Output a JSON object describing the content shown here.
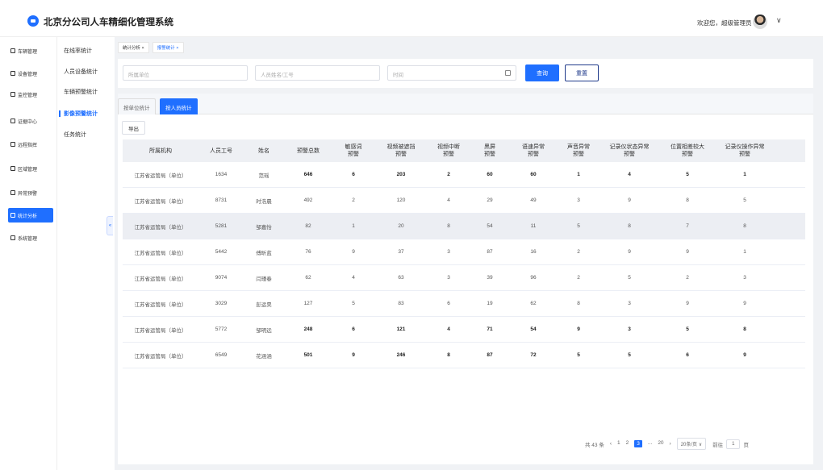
{
  "header": {
    "title": "北京分公司人车精细化管理系统",
    "welcome": "欢迎您，超级管理员",
    "caret": "∨"
  },
  "sidebar": {
    "items": [
      {
        "label": "车辆管理",
        "icon": "car-icon"
      },
      {
        "label": "设备管理",
        "icon": "device-icon"
      },
      {
        "label": "监控管理",
        "icon": "monitor-icon"
      },
      {
        "label": "证据中心",
        "icon": "evidence-icon"
      },
      {
        "label": "远程指挥",
        "icon": "command-icon"
      },
      {
        "label": "区域管理",
        "icon": "region-icon"
      },
      {
        "label": "异常预警",
        "icon": "warning-icon"
      },
      {
        "label": "统计分析",
        "icon": "chart-icon"
      },
      {
        "label": "系统管理",
        "icon": "settings-icon"
      }
    ],
    "active_index": 7
  },
  "subsidebar": {
    "items": [
      "在线率统计",
      "人员设备统计",
      "车辆预警统计",
      "影像预警统计",
      "任务统计"
    ],
    "active_index": 3,
    "collapse_glyph": "«"
  },
  "breadcrumbs": [
    {
      "label": "统计分析 ×"
    },
    {
      "label": "报警统计 ×"
    }
  ],
  "search": {
    "unit_placeholder": "所属单位",
    "person_placeholder": "人员姓名/工号",
    "time_placeholder": "时间",
    "query_label": "查询",
    "reset_label": "重置"
  },
  "tabs": [
    "按单位统计",
    "按人员统计"
  ],
  "active_tab": 1,
  "export_label": "导出",
  "table": {
    "headers": [
      [
        "所属机构"
      ],
      [
        "人员工号"
      ],
      [
        "姓名"
      ],
      [
        "预警总数"
      ],
      [
        "敏感词",
        "预警"
      ],
      [
        "视频被遮挡",
        "预警"
      ],
      [
        "视频中断",
        "预警"
      ],
      [
        "黑屏",
        "预警"
      ],
      [
        "语速异常",
        "预警"
      ],
      [
        "声音异常",
        "预警"
      ],
      [
        "记录仪状态异常",
        "预警"
      ],
      [
        "位置相差较大",
        "预警"
      ],
      [
        "记录仪操作异常",
        "预警"
      ]
    ],
    "rows": [
      [
        "江苏省运管局（单位）",
        "1634",
        "范瑶",
        "646",
        "6",
        "203",
        "2",
        "60",
        "60",
        "1",
        "4",
        "5",
        "1"
      ],
      [
        "江苏省运管局（单位）",
        "8731",
        "时浩晨",
        "492",
        "2",
        "120",
        "4",
        "29",
        "49",
        "3",
        "9",
        "8",
        "5"
      ],
      [
        "江苏省运管局（单位）",
        "5281",
        "邹嘉怡",
        "82",
        "1",
        "20",
        "8",
        "54",
        "11",
        "5",
        "8",
        "7",
        "8"
      ],
      [
        "江苏省运管局（单位）",
        "5442",
        "傅昕蓝",
        "76",
        "9",
        "37",
        "3",
        "87",
        "16",
        "2",
        "9",
        "9",
        "1"
      ],
      [
        "江苏省运管局（单位）",
        "9074",
        "闫瑾春",
        "62",
        "4",
        "63",
        "3",
        "39",
        "96",
        "2",
        "5",
        "2",
        "3"
      ],
      [
        "江苏省运管局（单位）",
        "3029",
        "彭运昊",
        "127",
        "5",
        "83",
        "6",
        "19",
        "62",
        "8",
        "3",
        "9",
        "9"
      ],
      [
        "江苏省运管局（单位）",
        "5772",
        "邹明远",
        "248",
        "6",
        "121",
        "4",
        "71",
        "54",
        "9",
        "3",
        "5",
        "8"
      ],
      [
        "江苏省运管局（单位）",
        "6549",
        "花涵涵",
        "501",
        "9",
        "246",
        "8",
        "87",
        "72",
        "5",
        "5",
        "6",
        "9"
      ]
    ],
    "highlight_row": 2,
    "bold_rows": [
      0,
      6,
      7
    ]
  },
  "pagination": {
    "total": "共 43 条",
    "prev": "‹",
    "pages": [
      "1",
      "2",
      "3",
      "...",
      "20"
    ],
    "current": "3",
    "next": "›",
    "page_size": "20条/页 ∨",
    "goto_label": "前往",
    "goto_value": "1",
    "page_unit": "页"
  },
  "colors": {
    "accent": "#1f6fff"
  }
}
